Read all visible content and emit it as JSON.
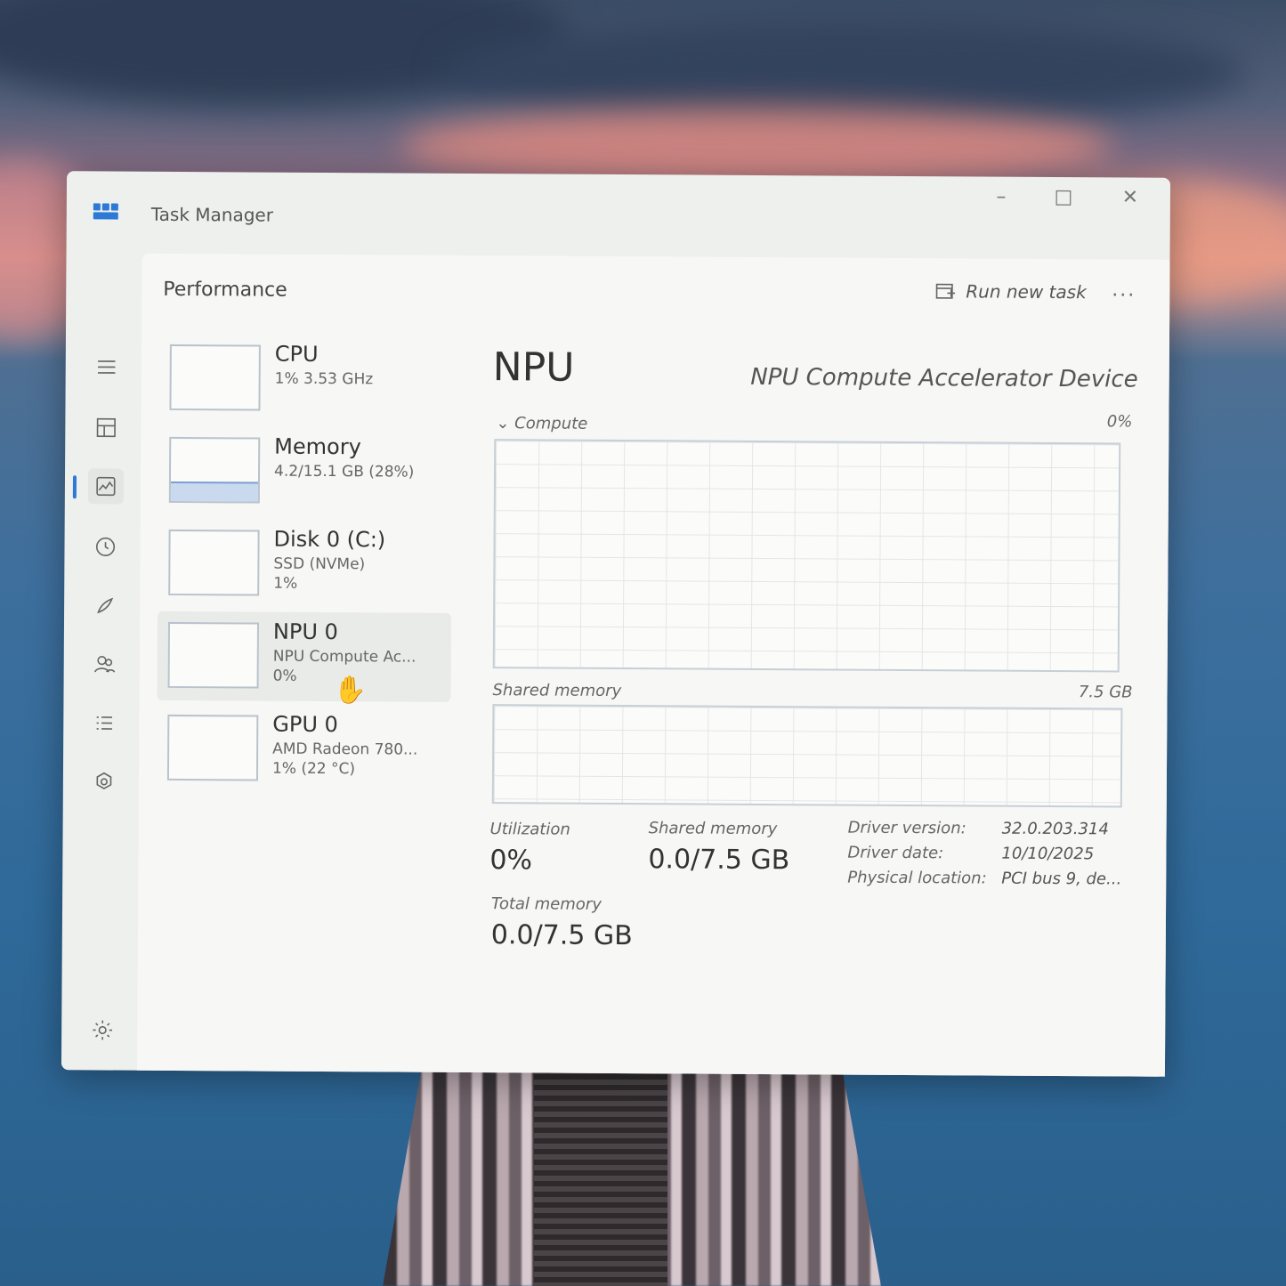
{
  "window": {
    "title": "Task Manager"
  },
  "header": {
    "page_title": "Performance",
    "run_new_task": "Run new task",
    "more": "..."
  },
  "devices": [
    {
      "name": "CPU",
      "sub": "1% 3.53 GHz",
      "sub2": ""
    },
    {
      "name": "Memory",
      "sub": "4.2/15.1 GB (28%)",
      "sub2": ""
    },
    {
      "name": "Disk 0 (C:)",
      "sub": "SSD (NVMe)",
      "sub2": "1%"
    },
    {
      "name": "NPU 0",
      "sub": "NPU Compute Ac...",
      "sub2": "0%"
    },
    {
      "name": "GPU 0",
      "sub": "AMD Radeon 780...",
      "sub2": "1% (22 °C)"
    }
  ],
  "memory_fill_fraction": 0.28,
  "detail": {
    "title": "NPU",
    "device_name": "NPU Compute Accelerator Device",
    "compute_label": "Compute",
    "compute_max": "0%",
    "shared_memory_label": "Shared memory",
    "shared_memory_max": "7.5 GB",
    "utilization_label": "Utilization",
    "utilization_value": "0%",
    "shared_memory_stat_label": "Shared memory",
    "shared_memory_stat_value": "0.0/7.5 GB",
    "total_memory_label": "Total memory",
    "total_memory_value": "0.0/7.5 GB",
    "driver_version_label": "Driver version:",
    "driver_version_value": "32.0.203.314",
    "driver_date_label": "Driver date:",
    "driver_date_value": "10/10/2025",
    "physical_location_label": "Physical location:",
    "physical_location_value": "PCI bus 9, de..."
  }
}
